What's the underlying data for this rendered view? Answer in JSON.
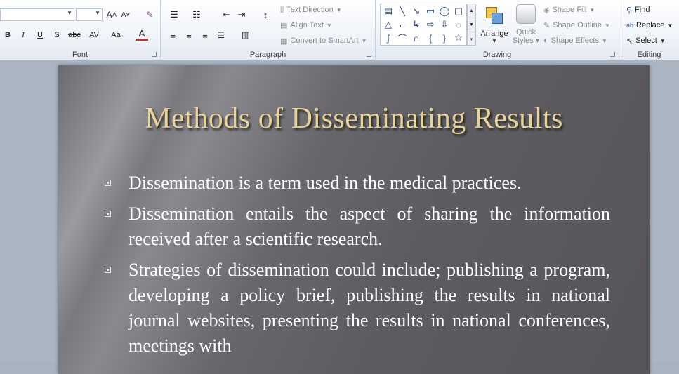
{
  "ribbon": {
    "font": {
      "label": "Font",
      "grow_icon": "A˄",
      "shrink_icon": "A˅",
      "bold": "B",
      "italic": "I",
      "underline": "U",
      "shadow": "S",
      "strike": "abc",
      "spacing": "AV",
      "case": "Aa",
      "color": "A"
    },
    "paragraph": {
      "label": "Paragraph",
      "text_direction": "Text Direction",
      "align_text": "Align Text",
      "convert_smartart": "Convert to SmartArt"
    },
    "drawing": {
      "label": "Drawing",
      "arrange": "Arrange",
      "quick_styles_line1": "Quick",
      "quick_styles_line2": "Styles",
      "shape_fill": "Shape Fill",
      "shape_outline": "Shape Outline",
      "shape_effects": "Shape Effects"
    },
    "editing": {
      "label": "Editing",
      "find": "Find",
      "replace": "Replace",
      "select": "Select"
    }
  },
  "slide": {
    "title": "Methods of Disseminating Results",
    "bullets": [
      "Dissemination is a term used in the medical practices.",
      "Dissemination entails the aspect of sharing the information received after a scientific research.",
      "Strategies of dissemination could include; publishing a program, developing a policy brief, publishing the results in national journal websites, presenting the results in national conferences, meetings with"
    ]
  },
  "colors": {
    "title": "#e7d39a",
    "body_text": "#ffffff",
    "slide_bg": "#616065",
    "ribbon_bg": "#eef2f8"
  }
}
